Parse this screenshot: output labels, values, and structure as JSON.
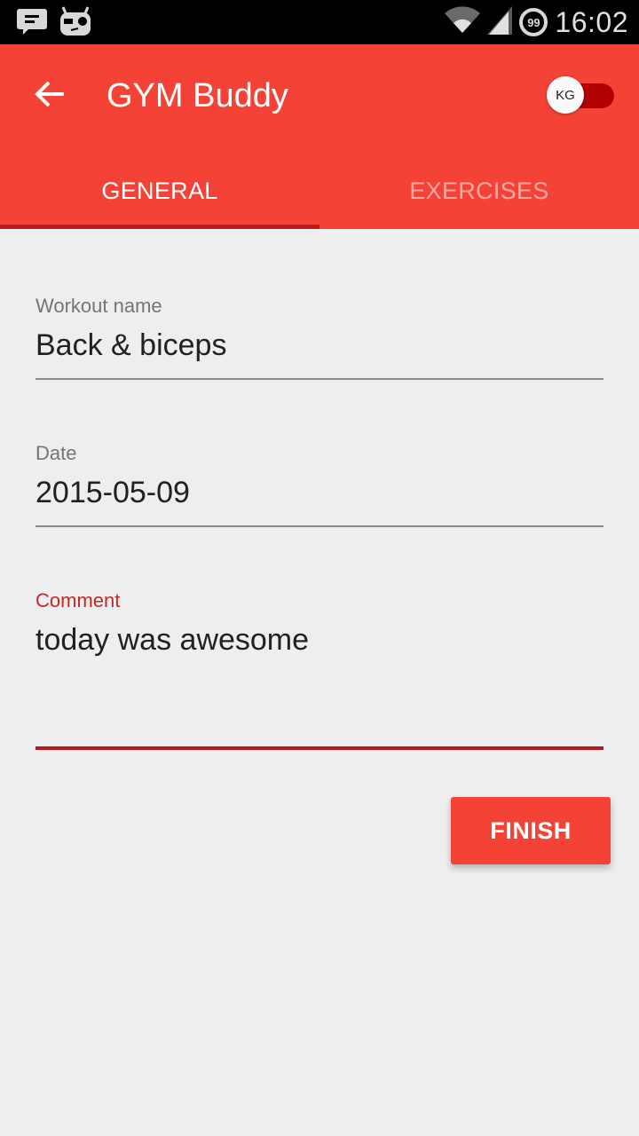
{
  "status_bar": {
    "left_icons": [
      "chat-notification-icon",
      "cyanogenmod-mascot-icon"
    ],
    "right_icons": [
      "wifi-icon",
      "cell-signal-icon",
      "notification-count-icon"
    ],
    "notification_count": "99",
    "time": "16:02"
  },
  "appbar": {
    "back_icon": "arrow-back-icon",
    "title": "GYM Buddy",
    "unit_toggle": {
      "label": "KG",
      "on": true
    },
    "colors": {
      "primary": "#f44336",
      "accent_dark": "#b71c1c"
    }
  },
  "tabs": [
    {
      "label": "GENERAL",
      "selected": true
    },
    {
      "label": "EXERCISES",
      "selected": false
    }
  ],
  "form": {
    "workout_name": {
      "label": "Workout name",
      "value": "Back & biceps"
    },
    "date": {
      "label": "Date",
      "value": "2015-05-09"
    },
    "comment": {
      "label": "Comment",
      "value": "today was awesome",
      "focused": true
    }
  },
  "actions": {
    "finish_label": "FINISH"
  }
}
